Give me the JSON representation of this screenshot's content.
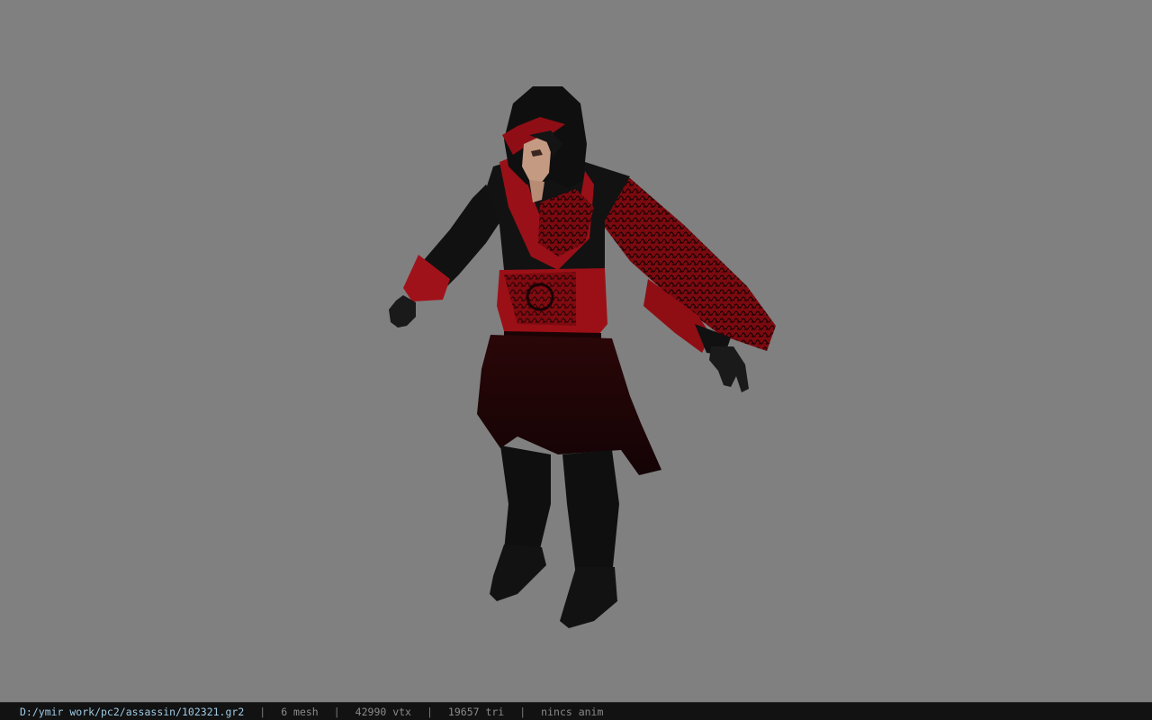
{
  "viewer": {
    "background_color": "#808080",
    "model_subject": "hooded-assassin-character"
  },
  "statusbar": {
    "file_path": "D:/ymir work/pc2/assassin/102321.gr2",
    "separator": "|",
    "mesh_count": "6 mesh",
    "vertex_count": "42990 vtx",
    "triangle_count": "19657 tri",
    "animation": "nincs anim",
    "path_color": "#9ec9e4",
    "text_color": "#8a8a8a"
  }
}
